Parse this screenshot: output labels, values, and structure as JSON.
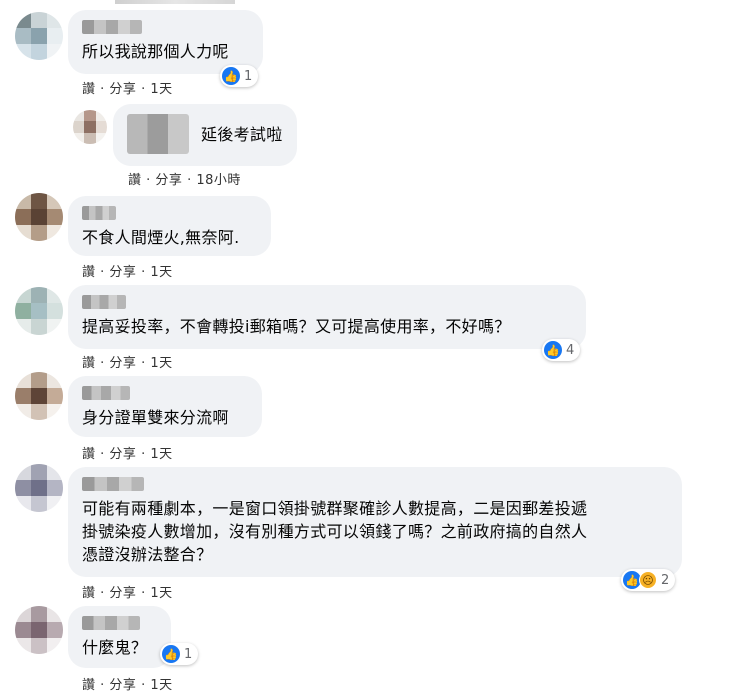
{
  "comments": [
    {
      "text": "所以我說那個人力呢",
      "meta_like": "讚",
      "meta_share": "分享",
      "meta_time": "1天",
      "reactions": "1"
    },
    {
      "text": "延後考試啦",
      "meta_like": "讚",
      "meta_share": "分享",
      "meta_time": "18小時"
    },
    {
      "text": "不食人間煙火,無奈阿.",
      "meta_like": "讚",
      "meta_share": "分享",
      "meta_time": "1天"
    },
    {
      "text": "提高妥投率，不會轉投i郵箱嗎？又可提高使用率，不好嗎？",
      "meta_like": "讚",
      "meta_share": "分享",
      "meta_time": "1天",
      "reactions": "4"
    },
    {
      "text": "身分證單雙來分流啊",
      "meta_like": "讚",
      "meta_share": "分享",
      "meta_time": "1天"
    },
    {
      "text": "可能有兩種劇本，一是窗口領掛號群聚確診人數提高，二是因郵差投遞\n掛號染疫人數增加，沒有別種方式可以領錢了嗎？之前政府搞的自然人\n憑證沒辦法整合？",
      "meta_like": "讚",
      "meta_share": "分享",
      "meta_time": "1天",
      "reactions": "2"
    },
    {
      "text": "什麼鬼？",
      "meta_like": "讚",
      "meta_share": "分享",
      "meta_time": "1天",
      "reactions": "1"
    }
  ],
  "sep": " · ",
  "icons": {
    "like": "like-icon",
    "sad": "sad-icon"
  }
}
